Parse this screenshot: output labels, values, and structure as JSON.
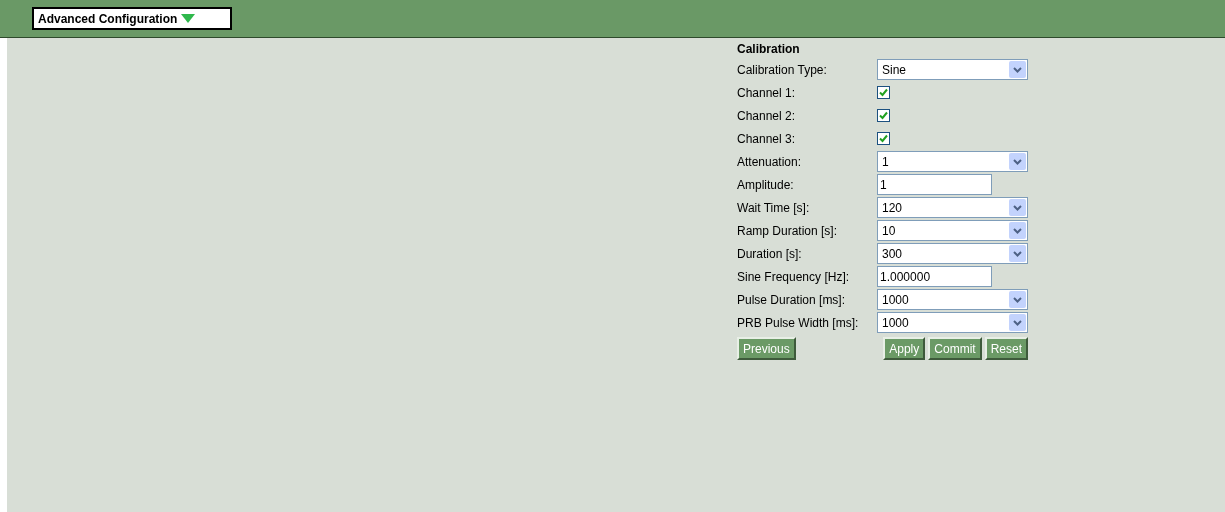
{
  "menu": {
    "label": "Advanced Configuration"
  },
  "form": {
    "title": "Calibration",
    "fields": [
      {
        "kind": "select",
        "label": "Calibration Type:",
        "value": "Sine"
      },
      {
        "kind": "checkbox",
        "label": "Channel 1:",
        "checked": true
      },
      {
        "kind": "checkbox",
        "label": "Channel 2:",
        "checked": true
      },
      {
        "kind": "checkbox",
        "label": "Channel 3:",
        "checked": true
      },
      {
        "kind": "select",
        "label": "Attenuation:",
        "value": "1"
      },
      {
        "kind": "input",
        "label": "Amplitude:",
        "value": "1"
      },
      {
        "kind": "select",
        "label": "Wait Time [s]:",
        "value": "120"
      },
      {
        "kind": "select",
        "label": "Ramp Duration [s]:",
        "value": "10"
      },
      {
        "kind": "select",
        "label": "Duration [s]:",
        "value": "300"
      },
      {
        "kind": "input",
        "label": "Sine Frequency [Hz]:",
        "value": "1.000000"
      },
      {
        "kind": "select",
        "label": "Pulse Duration [ms]:",
        "value": "1000"
      },
      {
        "kind": "select",
        "label": "PRB Pulse Width [ms]:",
        "value": "1000"
      }
    ],
    "buttons": [
      {
        "label": "Previous",
        "kind": "nav"
      },
      {
        "label": "Apply",
        "kind": "action"
      },
      {
        "label": "Commit",
        "kind": "action"
      },
      {
        "label": "Reset",
        "kind": "action"
      }
    ]
  }
}
